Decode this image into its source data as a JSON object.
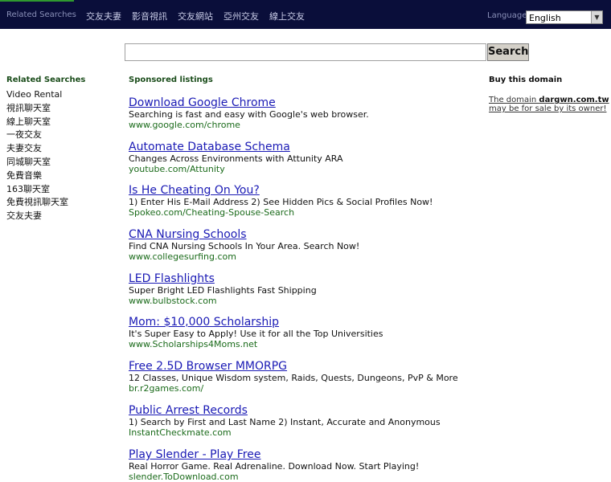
{
  "header": {
    "related_label": "Related Searches",
    "nav": [
      "交友夫妻",
      "影音視訊",
      "交友網站",
      "亞州交友",
      "線上交友"
    ],
    "language_label": "Language",
    "language_value": "English"
  },
  "search": {
    "button_label": "Search",
    "value": ""
  },
  "sidebar": {
    "heading": "Related Searches",
    "items": [
      "Video Rental",
      "視訊聊天室",
      "線上聊天室",
      "一夜交友",
      "夫妻交友",
      "同城聊天室",
      "免費音樂",
      "163聊天室",
      "免費視訊聊天室",
      "交友夫妻"
    ]
  },
  "sponsored": {
    "heading": "Sponsored listings",
    "ads": [
      {
        "title": "Download Google Chrome",
        "desc": "Searching is fast and easy with Google's web browser.",
        "url": "www.google.com/chrome"
      },
      {
        "title": "Automate Database Schema",
        "desc": "Changes Across Environments with Attunity ARA",
        "url": "youtube.com/Attunity"
      },
      {
        "title": "Is He Cheating On You?",
        "desc": "1) Enter His E-Mail Address 2) See Hidden Pics & Social Profiles Now!",
        "url": "Spokeo.com/Cheating-Spouse-Search"
      },
      {
        "title": "CNA Nursing Schools",
        "desc": "Find CNA Nursing Schools In Your Area. Search Now!",
        "url": "www.collegesurfing.com"
      },
      {
        "title": "LED Flashlights",
        "desc": "Super Bright LED Flashlights Fast Shipping",
        "url": "www.bulbstock.com"
      },
      {
        "title": "Mom: $10,000 Scholarship",
        "desc": "It's Super Easy to Apply! Use it for all the Top Universities",
        "url": "www.Scholarships4Moms.net"
      },
      {
        "title": "Free 2.5D Browser MMORPG",
        "desc": "12 Classes, Unique Wisdom system, Raids, Quests, Dungeons, PvP & More",
        "url": "br.r2games.com/"
      },
      {
        "title": "Public Arrest Records",
        "desc": "1) Search by First and Last Name 2) Instant, Accurate and Anonymous",
        "url": "InstantCheckmate.com"
      },
      {
        "title": "Play Slender - Play Free",
        "desc": "Real Horror Game. Real Adrenaline. Download Now. Start Playing!",
        "url": "slender.ToDownload.com"
      }
    ]
  },
  "buy": {
    "heading": "Buy this domain",
    "text_before": "The domain ",
    "domain": "dargwn.com.tw",
    "text_after": " may be for sale by its owner!"
  }
}
